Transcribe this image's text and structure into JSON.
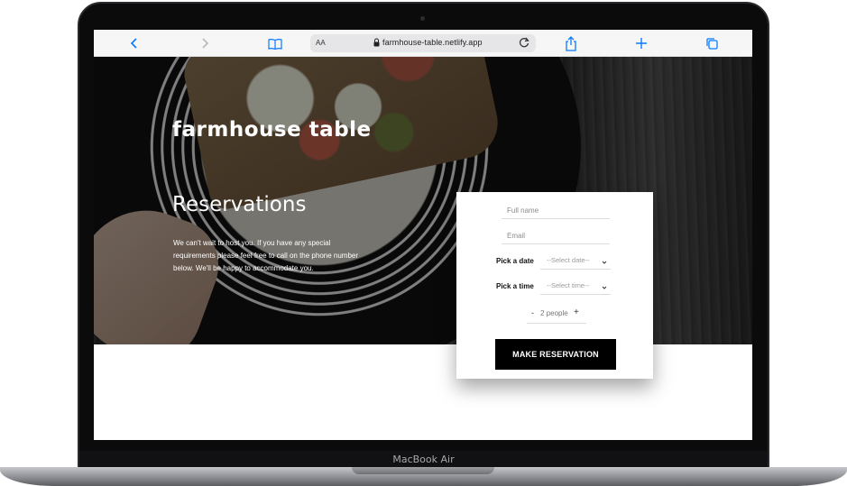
{
  "device": {
    "model_label": "MacBook Air"
  },
  "browser": {
    "text_size_label": "AA",
    "url": "farmhouse-table.netlify.app"
  },
  "site": {
    "brand": "farmhouse table",
    "heading": "Reservations",
    "intro": "We can't wait to host you. If you have any special requirements please feel free to call on the phone number below. We'll be happy to accommodate you."
  },
  "form": {
    "name_placeholder": "Full name",
    "email_placeholder": "Email",
    "date_label": "Pick a date",
    "date_placeholder": "--Select date--",
    "time_label": "Pick a time",
    "time_placeholder": "--Select time--",
    "decrement": "-",
    "people": "2 people",
    "increment": "+",
    "submit_label": "MAKE RESERVATION"
  },
  "icons": {
    "back": "chevron-left-icon",
    "forward": "chevron-right-icon",
    "bookmarks": "book-icon",
    "lock": "lock-icon",
    "reload": "reload-icon",
    "share": "share-icon",
    "new_tab": "plus-icon",
    "tabs": "tabs-icon"
  },
  "colors": {
    "accent": "#0a7aff",
    "button_bg": "#000000",
    "card_bg": "#ffffff"
  }
}
